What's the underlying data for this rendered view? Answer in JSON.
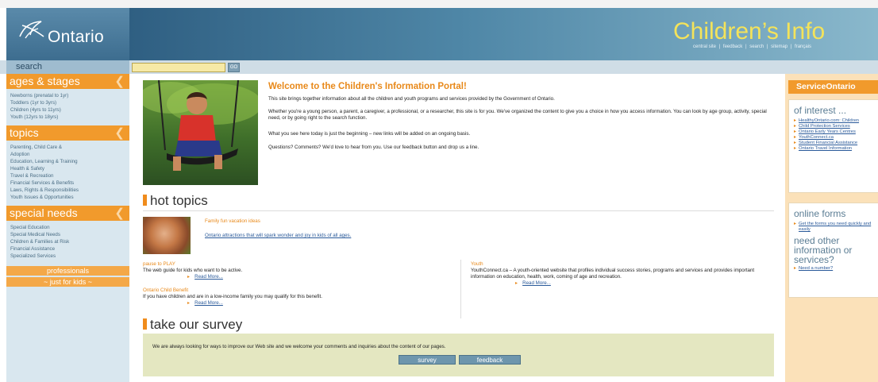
{
  "header": {
    "logo_text": "Ontario",
    "portal_title": "Children’s Info",
    "links": [
      "central site",
      "|",
      "feedback",
      "|",
      "search",
      "|",
      "sitemap",
      "|",
      "français"
    ]
  },
  "search": {
    "label": "search",
    "value": "",
    "go_label": "GO"
  },
  "sidebar": {
    "ages": {
      "title": "ages & stages",
      "items": [
        "Newborns (prenatal to 1yr)",
        "Toddlers (1yr to 3yrs)",
        "Children (4yrs to 11yrs)",
        "Youth (12yrs to 18yrs)"
      ]
    },
    "topics": {
      "title": "topics",
      "items": [
        "Parenting, Child Care &",
        "Adoption",
        "Education, Learning & Training",
        "Health & Safety",
        "Travel & Recreation",
        "Financial Services & Benefits",
        "Laws, Rights & Responsibilities",
        "Youth Issues & Opportunities"
      ]
    },
    "special": {
      "title": "special needs",
      "items": [
        "Special Education",
        "Special Medical Needs",
        "Children & Families at Risk",
        "Financial Assistance",
        "Specialized Services"
      ]
    },
    "professionals_label": "professionals",
    "kids_label": "~ just for kids ~"
  },
  "main": {
    "welcome_title": "Welcome to the Children's Information Portal!",
    "intro": [
      "This site brings together information about all the children and youth programs and services provided by the Government of Ontario.",
      "Whether you're a young person, a parent, a caregiver, a professional, or a researcher, this site is for you. We've organized the content to give you a choice in how you access information. You can look by age group, activity, special need, or by going right to the search function.",
      "What you see here today is just the beginning – new links will be added on an ongoing basis.",
      "Questions? Comments? We'd love to hear from you. Use our feedback button and drop us a line."
    ],
    "hot_topics_title": "hot topics",
    "hot_link1": "Family fun vacation ideas",
    "hot_link2": "Ontario attractions that will spark wonder and joy in kids of all ages.",
    "play": {
      "title": "pause to PLAY",
      "desc": "The web guide for kids who want to be active.",
      "more": "Read More..."
    },
    "benefit": {
      "title": "Ontario Child Benefit",
      "desc": "If you have children and are in a low-income family you may qualify for this benefit.",
      "more": "Read More..."
    },
    "youth": {
      "title": "Youth",
      "desc": "YouthConnect.ca – A youth-oriented website that profiles individual success stories, programs and services and provides important information on education, health, work, coming of age and recreation.",
      "more": "Read More..."
    },
    "survey_title": "take our survey",
    "survey_text": "We are always looking for ways to improve our Web site and we welcome your comments and inquiries about the content of our pages.",
    "survey_button": "survey",
    "feedback_button": "feedback"
  },
  "right": {
    "service_title": "ServiceOntario",
    "interest_title": "of interest ...",
    "interest_links": [
      "HealthyOntario.com: Children",
      "Child Protection Services",
      "Ontario Early Years Centres",
      "YouthConnect.ca",
      "Student Financial Assistance",
      "Ontario Travel Information"
    ],
    "forms_title": "online forms",
    "forms_link": "Get the forms you need quickly and easily",
    "other_title": "need other information or services?",
    "number_link": "Need a number?"
  },
  "colors": {
    "accent_orange": "#f19a2c",
    "portal_yellow": "#f4e35a",
    "link_blue": "#2a5a9a"
  },
  "icons": [
    "ontario-trillium-logo-icon",
    "arrow-bullet-icon"
  ]
}
